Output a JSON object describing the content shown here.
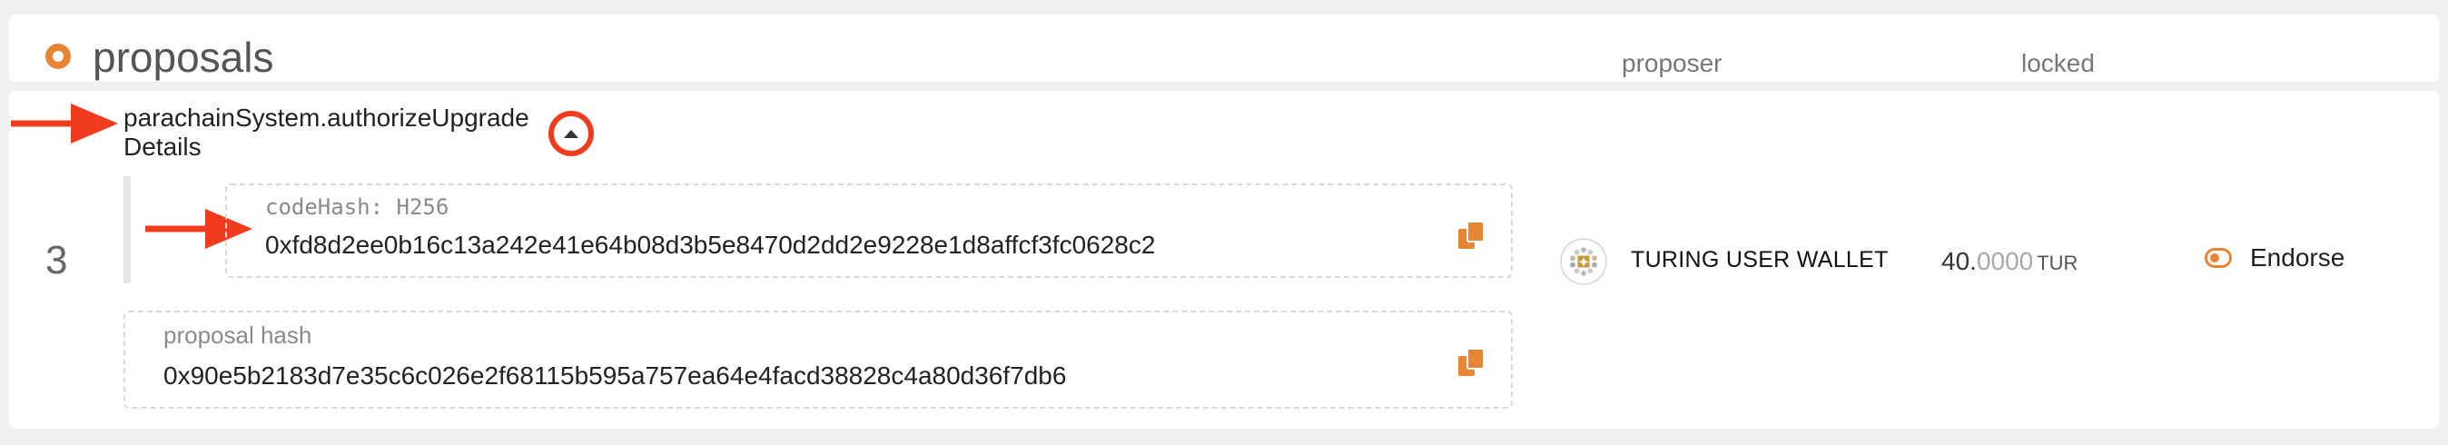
{
  "header": {
    "title": "proposals",
    "columns": {
      "proposer": "proposer",
      "locked": "locked"
    }
  },
  "proposal": {
    "index": "3",
    "method": "parachainSystem.authorizeUpgrade",
    "details_label": "Details",
    "params": [
      {
        "label": "codeHash: H256",
        "value": "0xfd8d2ee0b16c13a242e41e64b08d3b5e8470d2dd2e9228e1d8affcf3fc0628c2"
      }
    ],
    "proposal_hash": {
      "label": "proposal hash",
      "value": "0x90e5b2183d7e35c6c026e2f68115b595a757ea64e4facd38828c4a80d36f7db6"
    },
    "proposer": {
      "name": "TURING USER WALLET",
      "icon": "identicon"
    },
    "locked": {
      "integer": "40.",
      "decimals": "0000",
      "unit": "TUR"
    },
    "action": {
      "label": "Endorse",
      "icon": "toggle-icon"
    }
  },
  "colors": {
    "accent": "#e88534",
    "annotation_red": "#f03b1f",
    "background": "#f0f0ee"
  },
  "annotations": [
    "red-arrow-method",
    "red-circle-toggle",
    "red-arrow-codehash"
  ]
}
